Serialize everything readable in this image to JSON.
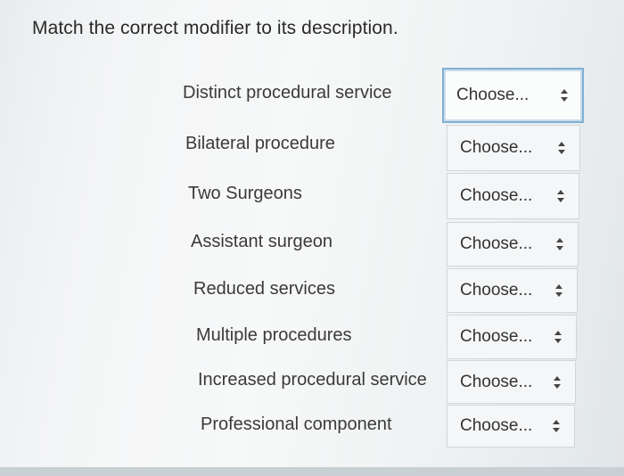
{
  "question": "Match the correct modifier to its description.",
  "select_placeholder": "Choose...",
  "items": [
    {
      "term": "Distinct procedural service",
      "selected": "Choose..."
    },
    {
      "term": "Bilateral procedure",
      "selected": "Choose..."
    },
    {
      "term": "Two Surgeons",
      "selected": "Choose..."
    },
    {
      "term": "Assistant surgeon",
      "selected": "Choose..."
    },
    {
      "term": "Reduced services",
      "selected": "Choose..."
    },
    {
      "term": "Multiple procedures",
      "selected": "Choose..."
    },
    {
      "term": "Increased procedural service",
      "selected": "Choose..."
    },
    {
      "term": "Professional component",
      "selected": "Choose..."
    }
  ],
  "icons": {
    "select_arrow": "up-down-chevron-icon"
  }
}
